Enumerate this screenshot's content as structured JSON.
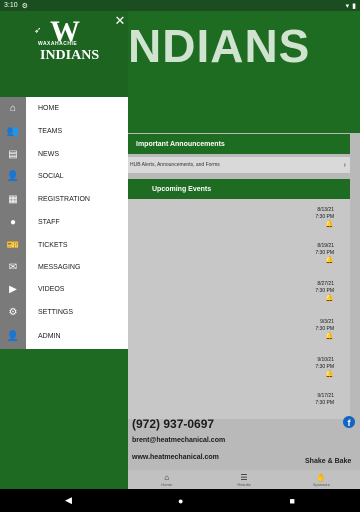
{
  "status": {
    "time": "3:10",
    "battery": "▮",
    "wifi": "▾"
  },
  "background": {
    "header_title": "NDIANS",
    "announcements_title": "Important Announcements",
    "announcements_row": "HUB Alerts, Announcements, and Forms",
    "upcoming_title": "Upcoming Events",
    "events": [
      {
        "date": "8/13/21",
        "time": "7:30 PM"
      },
      {
        "date": "8/19/21",
        "time": "7:30 PM"
      },
      {
        "date": "8/27/21",
        "time": "7:30 PM"
      },
      {
        "date": "9/3/21",
        "time": "7:30 PM"
      },
      {
        "date": "9/10/21",
        "time": "7:30 PM"
      },
      {
        "date": "9/17/21",
        "time": "7:30 PM"
      }
    ],
    "phone": "(972) 937-0697",
    "email": "brent@heatmechanical.com",
    "website": "www.heatmechanical.com",
    "sponsor": "Shake & Bake",
    "tabs": [
      {
        "label": "Home",
        "icon": "home-icon"
      },
      {
        "label": "Results",
        "icon": "list-icon"
      },
      {
        "label": "Sponsors",
        "icon": "handshake-icon"
      }
    ]
  },
  "drawer": {
    "logo": {
      "letter": "W",
      "sub": "WAXAHACHIE",
      "name": "INDIANS"
    },
    "close": "✕",
    "items": [
      {
        "label": "HOME",
        "icon": "home-icon"
      },
      {
        "label": "TEAMS",
        "icon": "teams-icon"
      },
      {
        "label": "NEWS",
        "icon": "news-icon"
      },
      {
        "label": "SOCIAL",
        "icon": "social-icon"
      },
      {
        "label": "REGISTRATION",
        "icon": "registration-icon"
      },
      {
        "label": "STAFF",
        "icon": "staff-icon"
      },
      {
        "label": "TICKETS",
        "icon": "ticket-icon"
      },
      {
        "label": "MESSAGING",
        "icon": "mail-icon"
      },
      {
        "label": "VIDEOS",
        "icon": "play-icon"
      },
      {
        "label": "SETTINGS",
        "icon": "gear-icon"
      },
      {
        "label": "ADMIN",
        "icon": "admin-icon"
      }
    ]
  },
  "colors": {
    "brand_green": "#1f6a23",
    "icon_column": "#7a7a7a"
  }
}
